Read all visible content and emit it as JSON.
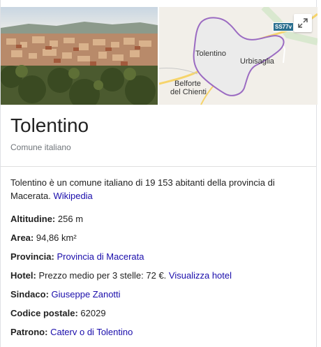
{
  "map": {
    "road_shield": "SS77v",
    "places": [
      "Tolentino",
      "Urbisaglia",
      "Belforte",
      "del Chienti"
    ]
  },
  "entity": {
    "title": "Tolentino",
    "subtitle": "Comune italiano"
  },
  "description": {
    "text": "Tolentino è un comune italiano di 19 153 abitanti della provincia di Macerata.",
    "source_link": "Wikipedia"
  },
  "facts": [
    {
      "label": "Altitudine:",
      "value": "256 m",
      "link": ""
    },
    {
      "label": "Area:",
      "value": "94,86 km²",
      "link": ""
    },
    {
      "label": "Provincia:",
      "value": "",
      "link": "Provincia di Macerata"
    },
    {
      "label": "Hotel:",
      "value": "Prezzo medio per 3 stelle: 72 €.",
      "link": "Visualizza hotel"
    },
    {
      "label": "Sindaco:",
      "value": "",
      "link": "Giuseppe Zanotti"
    },
    {
      "label": "Codice postale:",
      "value": "62029",
      "link": ""
    },
    {
      "label": "Patrono:",
      "value": "",
      "link": "Caterv o di Tolentino"
    }
  ],
  "colors": {
    "link": "#1a0dab",
    "boundary": "#9b6bc2",
    "road": "#f6d46b"
  },
  "icons": {
    "expand": "expand-icon"
  }
}
